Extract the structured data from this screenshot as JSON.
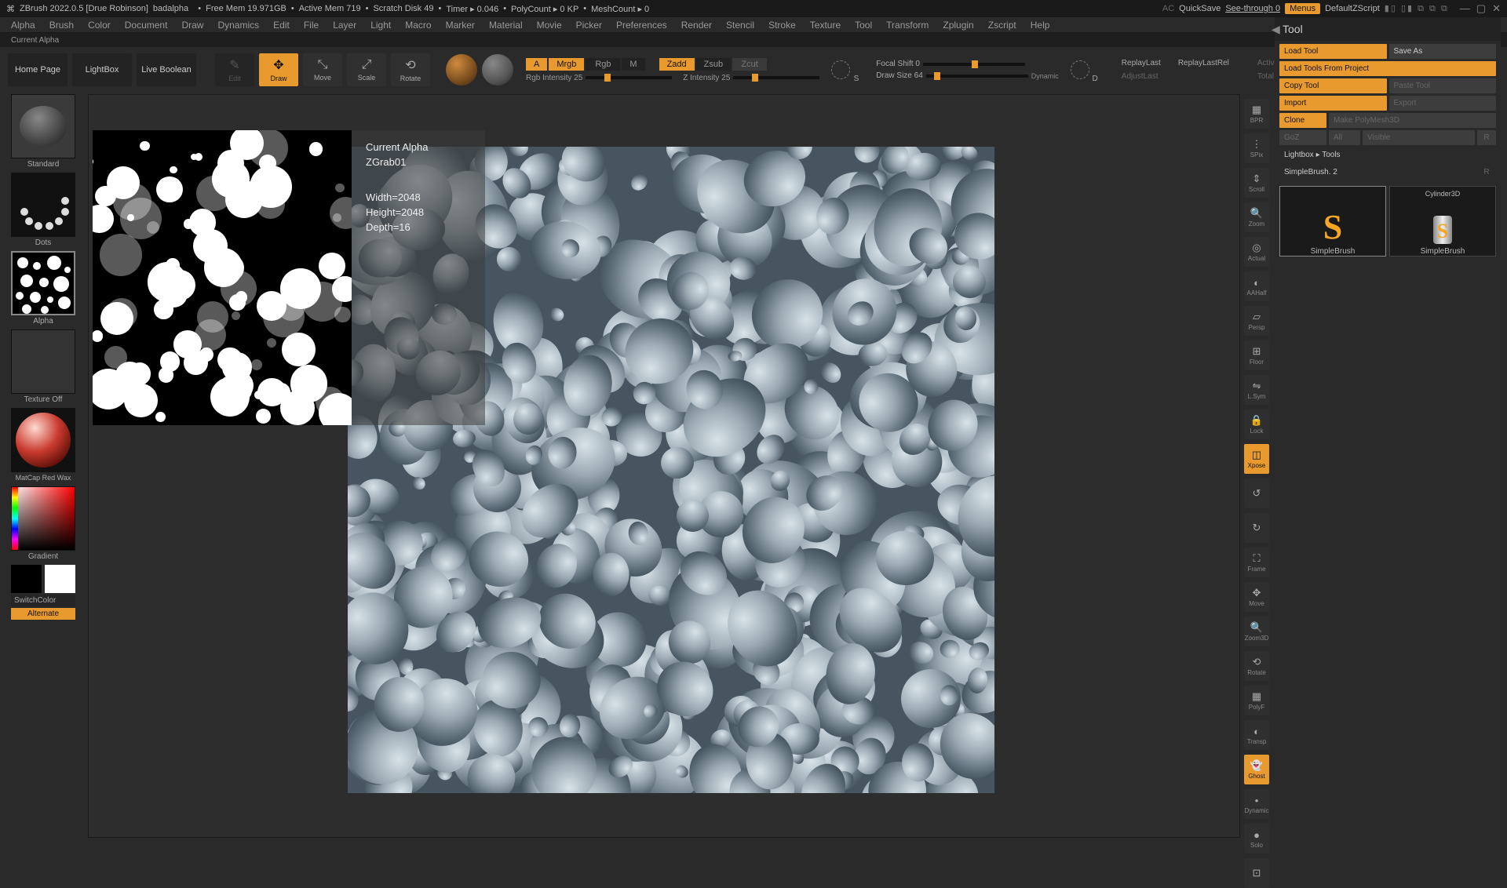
{
  "title": {
    "app": "ZBrush 2022.0.5 [Drue Robinson]",
    "doc": "badalpha",
    "freemem": "Free Mem 19.971GB",
    "activemem": "Active Mem 719",
    "scratch": "Scratch Disk 49",
    "timer": "Timer ▸ 0.046",
    "polycount": "PolyCount ▸ 0 KP",
    "meshcount": "MeshCount ▸ 0",
    "ac": "AC",
    "quicksave": "QuickSave",
    "seethrough": "See-through  0",
    "menus": "Menus",
    "zscript": "DefaultZScript"
  },
  "menu": [
    "Alpha",
    "Brush",
    "Color",
    "Document",
    "Draw",
    "Dynamics",
    "Edit",
    "File",
    "Layer",
    "Light",
    "Macro",
    "Marker",
    "Material",
    "Movie",
    "Picker",
    "Preferences",
    "Render",
    "Stencil",
    "Stroke",
    "Texture",
    "Tool",
    "Transform",
    "Zplugin",
    "Zscript",
    "Help"
  ],
  "status": "Current Alpha",
  "toolbar": {
    "homepage": "Home Page",
    "lightbox": "LightBox",
    "liveboolean": "Live Boolean",
    "edit": "Edit",
    "draw": "Draw",
    "move": "Move",
    "scale": "Scale",
    "rotate": "Rotate",
    "mode": {
      "a": "A",
      "mrgb": "Mrgb",
      "rgb": "Rgb",
      "m": "M",
      "zadd": "Zadd",
      "zsub": "Zsub",
      "zcut": "Zcut"
    },
    "rgbintensity": "Rgb Intensity 25",
    "zintensity": "Z Intensity 25",
    "focalshift": "Focal Shift 0",
    "drawsize": "Draw Size 64",
    "dynamic": "Dynamic",
    "replaylast": "ReplayLast",
    "replaylastrel": "ReplayLastRel",
    "adjustlast": "AdjustLast",
    "activepoints": "Active Points Count",
    "totalpoints": "Total Points Count"
  },
  "left": {
    "brushname": "Standard",
    "strokename": "Dots",
    "alphaname": "Alpha",
    "textureoff": "Texture Off",
    "materialname": "MatCap Red Wax",
    "gradient": "Gradient",
    "switchcolor": "SwitchColor",
    "alternate": "Alternate"
  },
  "alpha_info": {
    "title": "Current Alpha",
    "name": "ZGrab01",
    "width": "Width=2048",
    "height": "Height=2048",
    "depth": "Depth=16"
  },
  "right_icons": [
    "BPR",
    "SPix",
    "Scroll",
    "Zoom",
    "Actual",
    "AAHalf",
    "Persp",
    "Floor",
    "L.Sym",
    "Lock",
    "Xpose",
    "",
    "",
    "Frame",
    "Move",
    "Zoom3D",
    "Rotate",
    "PolyF",
    "Transp",
    "Ghost",
    "Dynamic",
    "Solo",
    ""
  ],
  "tool": {
    "header": "Tool",
    "loadtool": "Load Tool",
    "saveas": "Save As",
    "loadproject": "Load Tools From Project",
    "copytool": "Copy Tool",
    "pastetool": "Paste Tool",
    "import": "Import",
    "export": "Export",
    "clone": "Clone",
    "makepoly": "Make PolyMesh3D",
    "goz": "GoZ",
    "all": "All",
    "visible": "Visible",
    "r1": "R",
    "lightbox": "Lightbox ▸ Tools",
    "simplebrush2": "SimpleBrush. 2",
    "r2": "R",
    "thumb1": "SimpleBrush",
    "thumb2": "SimpleBrush",
    "thumb2top": "Cylinder3D"
  }
}
